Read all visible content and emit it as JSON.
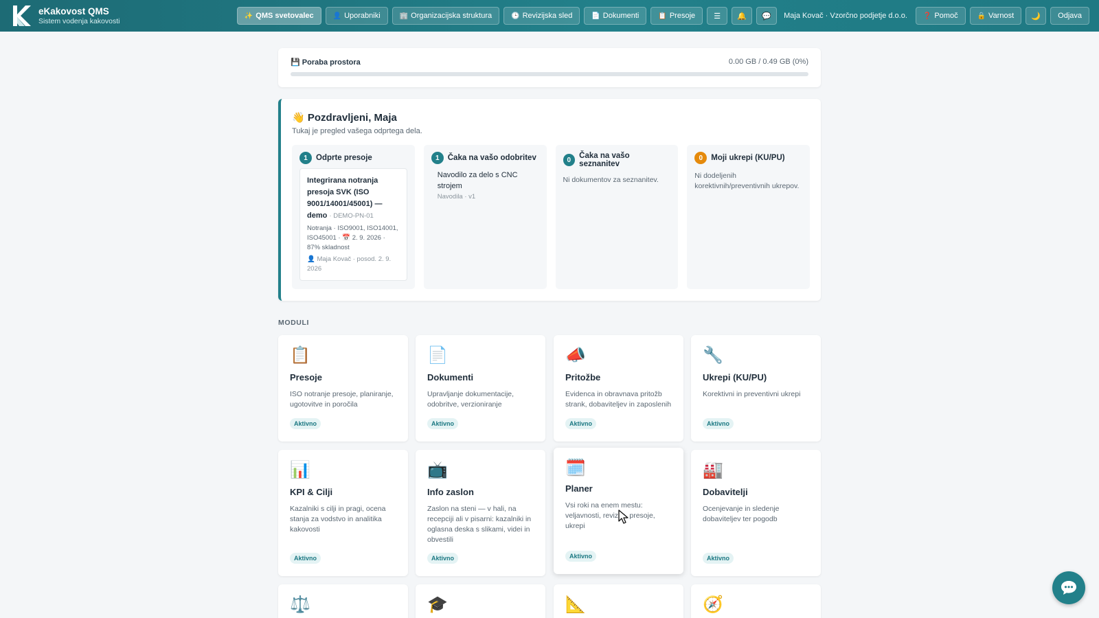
{
  "brand": {
    "title": "eKakovost QMS",
    "subtitle": "Sistem vodenja kakovosti"
  },
  "nav": {
    "wizard": "QMS svetovalec",
    "users": "Uporabniki",
    "org": "Organizacijska struktura",
    "audit_trail": "Revizijska sled",
    "documents": "Dokumenti",
    "audits": "Presoje",
    "menu_icon": "☰",
    "bell_icon": "🔔",
    "chat_icon": "💬",
    "user": "Maja Kovač · Vzorčno podjetje d.o.o.",
    "help": "Pomoč",
    "security": "Varnost",
    "theme_icon": "🌙",
    "logout": "Odjava"
  },
  "storage": {
    "label": "Poraba prostora",
    "value": "0.00 GB / 0.49 GB (0%)",
    "percent": 0
  },
  "welcome": {
    "greeting": "Pozdravljeni, Maja",
    "subtitle": "Tukaj je pregled vašega odprtega dela.",
    "open_audits": {
      "count": "1",
      "title": "Odprte presoje",
      "item_title": "Integrirana notranja presoja SVK (ISO 9001/14001/45001) — demo",
      "item_code": "· DEMO-PN-01",
      "item_meta": "Notranja · ISO9001, ISO14001, ISO45001 · 📅 2. 9. 2026 · 87% skladnost",
      "item_by": "👤 Maja Kovač · posod. 2. 9. 2026"
    },
    "approval": {
      "count": "1",
      "title": "Čaka na vašo odobritev",
      "item_title": "Navodilo za delo s CNC strojem",
      "item_meta": "Navodila · v1"
    },
    "acknowledge": {
      "count": "0",
      "title": "Čaka na vašo seznanitev",
      "empty": "Ni dokumentov za seznanitev."
    },
    "actions": {
      "count": "0",
      "title": "Moji ukrepi (KU/PU)",
      "empty": "Ni dodeljenih korektivnih/preventivnih ukrepov."
    }
  },
  "modules_label": "MODULI",
  "modules": [
    {
      "icon": "📋",
      "title": "Presoje",
      "desc": "ISO notranje presoje, planiranje, ugotovitve in poročila",
      "badge": "Aktivno"
    },
    {
      "icon": "📄",
      "title": "Dokumenti",
      "desc": "Upravljanje dokumentacije, odobritve, verzioniranje",
      "badge": "Aktivno"
    },
    {
      "icon": "📣",
      "title": "Pritožbe",
      "desc": "Evidenca in obravnava pritožb strank, dobaviteljev in zaposlenih",
      "badge": "Aktivno"
    },
    {
      "icon": "🔧",
      "title": "Ukrepi (KU/PU)",
      "desc": "Korektivni in preventivni ukrepi",
      "badge": "Aktivno"
    },
    {
      "icon": "📊",
      "title": "KPI & Cilji",
      "desc": "Kazalniki s cilji in pragi, ocena stanja za vodstvo in analitika kakovosti",
      "badge": "Aktivno"
    },
    {
      "icon": "📺",
      "title": "Info zaslon",
      "desc": "Zaslon na steni — v hali, na recepciji ali v pisarni: kazalniki in oglasna deska s slikami, videi in obvestili",
      "badge": "Aktivno"
    },
    {
      "icon": "🗓️",
      "title": "Planer",
      "desc": "Vsi roki na enem mestu: veljavnosti, revizije, presoje, ukrepi",
      "badge": "Aktivno"
    },
    {
      "icon": "🏭",
      "title": "Dobavitelji",
      "desc": "Ocenjevanje in sledenje dobaviteljev ter pogodb",
      "badge": "Aktivno"
    },
    {
      "icon": "⚖️"
    },
    {
      "icon": "🎓"
    },
    {
      "icon": "📐"
    },
    {
      "icon": "🧭"
    }
  ],
  "colors": {
    "primary": "#22808a",
    "topbar": "#1d6b75",
    "orange": "#e58a0c"
  }
}
